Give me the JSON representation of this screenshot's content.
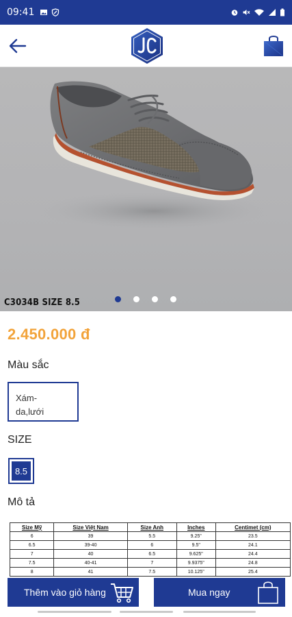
{
  "status_bar": {
    "time": "09:41",
    "left_icons": [
      "image-icon",
      "shield-icon"
    ],
    "right_icons": [
      "alarm-icon",
      "mute-icon",
      "wifi-icon",
      "signal-icon",
      "battery-icon"
    ],
    "bg_color": "#1f3a93"
  },
  "header": {
    "back_icon": "arrow-left-icon",
    "logo_letters": "JC",
    "bag_icon": "shopping-bag-icon"
  },
  "product": {
    "image_caption": "C3034B SIZE 8.5",
    "carousel_total": 4,
    "carousel_active": 1,
    "price": "2.450.000 đ",
    "price_color": "#f2a33a"
  },
  "color_section": {
    "label": "Màu sắc",
    "selected_line1": "Xám-",
    "selected_line2": "da,lưới"
  },
  "size_section": {
    "label": "SIZE",
    "selected": "8.5"
  },
  "description": {
    "label": "Mô tả",
    "size_table": {
      "headers": [
        "Size Mỹ",
        "Size Việt Nam",
        "Size Anh",
        "Inches",
        "Centimet (cm)"
      ],
      "rows": [
        [
          "6",
          "39",
          "5.5",
          "9.25\"",
          "23.5"
        ],
        [
          "6.5",
          "39-40",
          "6",
          "9.5\"",
          "24.1"
        ],
        [
          "7",
          "40",
          "6.5",
          "9.625\"",
          "24.4"
        ],
        [
          "7.5",
          "40-41",
          "7",
          "9.9375\"",
          "24.8"
        ],
        [
          "8",
          "41",
          "7.5",
          "10.125\"",
          "25.4"
        ]
      ]
    }
  },
  "actions": {
    "add_to_cart": "Thêm vào giỏ hàng",
    "add_to_cart_icon": "cart-icon",
    "buy_now": "Mua ngay",
    "buy_now_icon": "shopping-bag-icon",
    "accent_color": "#1f3a93"
  }
}
